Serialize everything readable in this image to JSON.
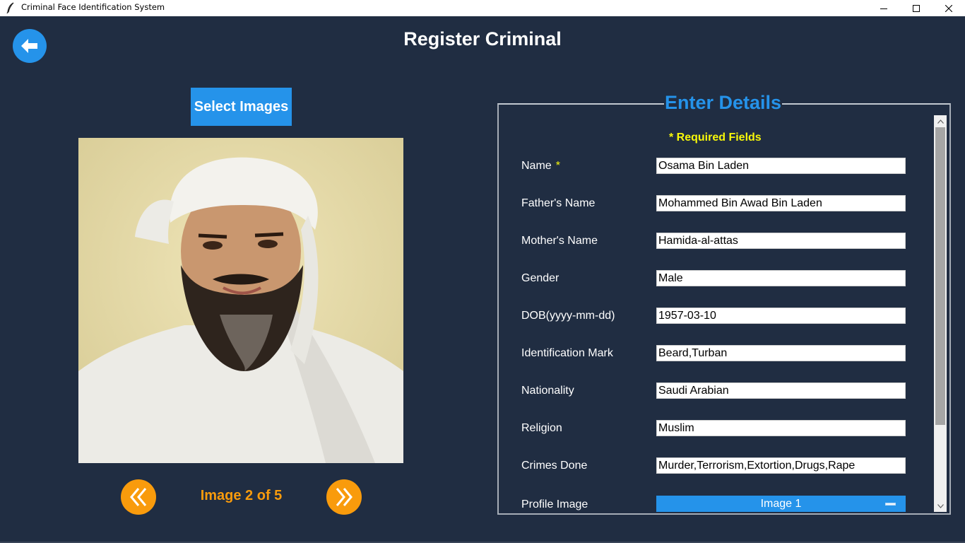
{
  "window": {
    "title": "Criminal Face Identification System",
    "icons": {
      "app": "feather-icon",
      "minimize": "minimize-icon",
      "maximize": "maximize-icon",
      "close": "close-icon"
    }
  },
  "header": {
    "title": "Register Criminal",
    "back_icon": "arrow-left-icon"
  },
  "left": {
    "select_images_label": "Select Images",
    "counter": "Image 2 of 5",
    "prev_icon": "double-chevron-left-icon",
    "next_icon": "double-chevron-right-icon"
  },
  "details": {
    "legend": "Enter Details",
    "required_note": "* Required Fields",
    "name_required_marker": "*",
    "fields": [
      {
        "label": "Name",
        "value": "Osama Bin Laden",
        "required": true
      },
      {
        "label": "Father's Name",
        "value": "Mohammed Bin Awad Bin Laden"
      },
      {
        "label": "Mother's Name",
        "value": "Hamida-al-attas"
      },
      {
        "label": "Gender",
        "value": "Male"
      },
      {
        "label": "DOB(yyyy-mm-dd)",
        "value": "1957-03-10"
      },
      {
        "label": "Identification Mark",
        "value": "Beard,Turban"
      },
      {
        "label": "Nationality",
        "value": "Saudi Arabian"
      },
      {
        "label": "Religion",
        "value": "Muslim"
      },
      {
        "label": "Crimes Done",
        "value": "Murder,Terrorism,Extortion,Drugs,Rape"
      }
    ],
    "profile_image": {
      "label": "Profile Image",
      "selected": "Image 1"
    }
  },
  "colors": {
    "background": "#202d42",
    "accent_blue": "#2593ea",
    "accent_orange": "#f99b0c",
    "required_yellow": "#f7f70a"
  }
}
